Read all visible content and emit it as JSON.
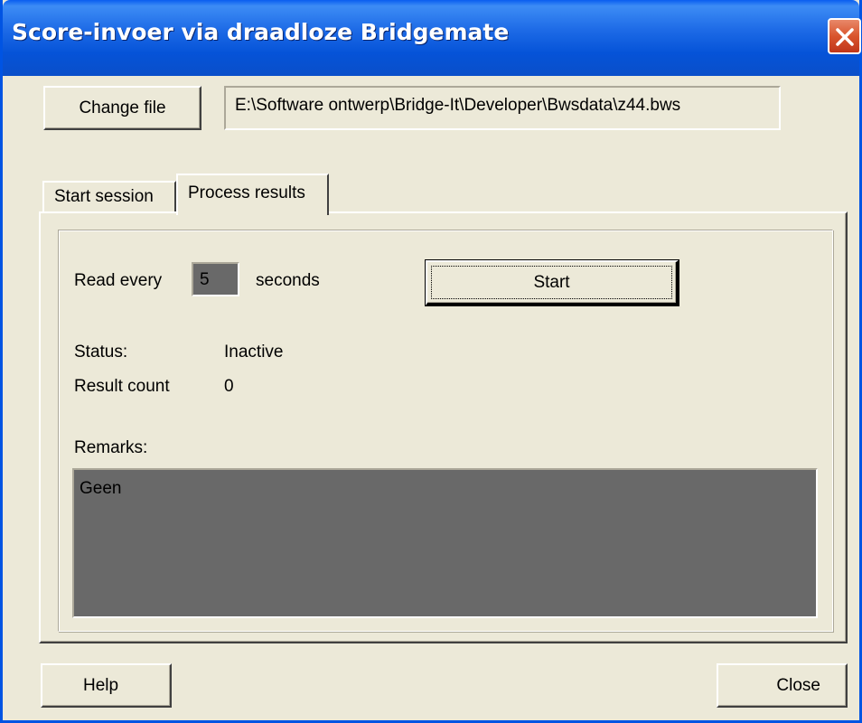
{
  "window": {
    "title": "Score-invoer via draadloze Bridgemate",
    "close_icon": "close-x-icon"
  },
  "file": {
    "change_label": "Change file",
    "path": "E:\\Software ontwerp\\Bridge-It\\Developer\\Bwsdata\\z44.bws"
  },
  "tabs": [
    {
      "label": "Start session",
      "active": false
    },
    {
      "label": "Process results",
      "active": true
    }
  ],
  "process": {
    "read_every_label": "Read every",
    "interval_value": "5",
    "seconds_label": "seconds",
    "start_label": "Start",
    "status_label": "Status:",
    "status_value": "Inactive",
    "result_count_label": "Result count",
    "result_count_value": "0",
    "remarks_label": "Remarks:",
    "remarks_value": "Geen"
  },
  "footer": {
    "help_label": "Help",
    "close_label": "Close"
  },
  "colors": {
    "titlebar": "#0553d8",
    "dialog_bg": "#ece9d8",
    "field_dark_bg": "#696969",
    "close_button": "#d9552d"
  }
}
